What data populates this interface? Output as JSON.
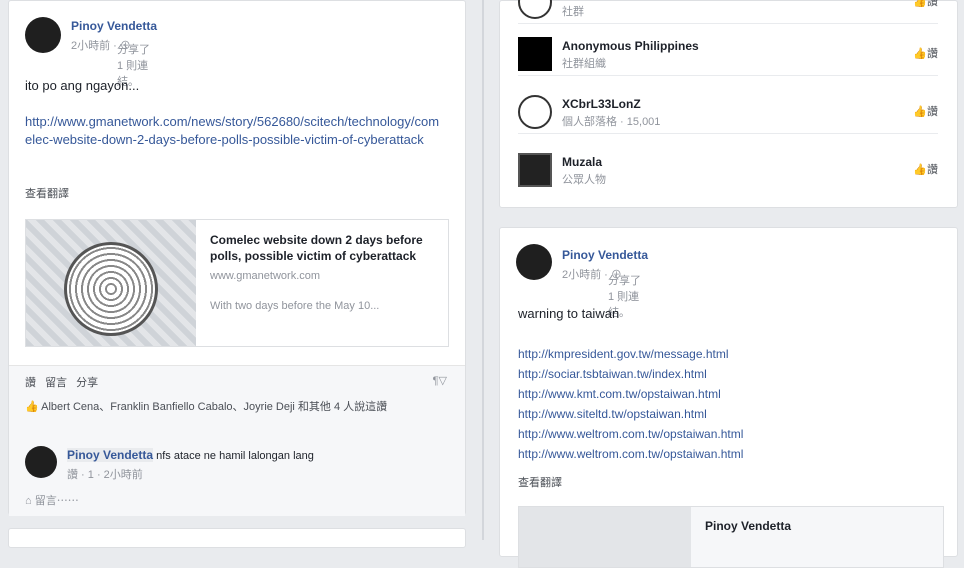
{
  "left_post": {
    "author": "Pinoy Vendetta",
    "header_suffix": "分享了 1 則連結。",
    "meta": "2小時前 · ⊕",
    "text": "ito po ang ngayon...",
    "link_url": "http://www.gmanetwork.com/news/story/562680/scitech/technology/comelec-website-down-2-days-before-polls-possible-victim-of-cyberattack",
    "see_translation": "查看翻譯",
    "link_card": {
      "title": "Comelec website down 2 days before polls, possible victim of cyberattack",
      "domain": "www.gmanetwork.com",
      "desc": "With two days before the May 10..."
    },
    "actions": [
      "讚",
      "留言",
      "分享"
    ],
    "translate_label": "¶▽",
    "likes_text": "Albert Cena、Franklin Banfiello Cabalo、Joyrie Deji 和其他 4 人說這讚",
    "comment": {
      "author": "Pinoy Vendetta",
      "text": "nfs atace ne hamil lalongan lang",
      "meta": "讚 · 1 · 2小時前"
    },
    "write_comment": "留言⋯⋯"
  },
  "suggestions": [
    {
      "name": "",
      "sub": "社群",
      "like": "讚"
    },
    {
      "name": "Anonymous Philippines",
      "sub": "社群組織",
      "like": "讚"
    },
    {
      "name": "XCbrL33LonZ",
      "sub": "個人部落格 · 15,001",
      "like": "讚"
    },
    {
      "name": "Muzala",
      "sub": "公眾人物",
      "like": "讚"
    }
  ],
  "right_post": {
    "author": "Pinoy Vendetta",
    "header_suffix": "分享了 1 則連結。",
    "meta": "2小時前 · ⊕",
    "text": "warning to taiwan",
    "urls": [
      "http://kmpresident.gov.tw/message.html",
      "http://sociar.tsbtaiwan.tw/index.html",
      "http://www.kmt.com.tw/opstaiwan.html",
      "http://www.siteltd.tw/opstaiwan.html",
      "http://www.weltrom.com.tw/opstaiwan.html",
      "http://www.weltrom.com.tw/opstaiwan.html"
    ],
    "see_translation": "查看翻譯",
    "shared_name": "Pinoy Vendetta"
  }
}
